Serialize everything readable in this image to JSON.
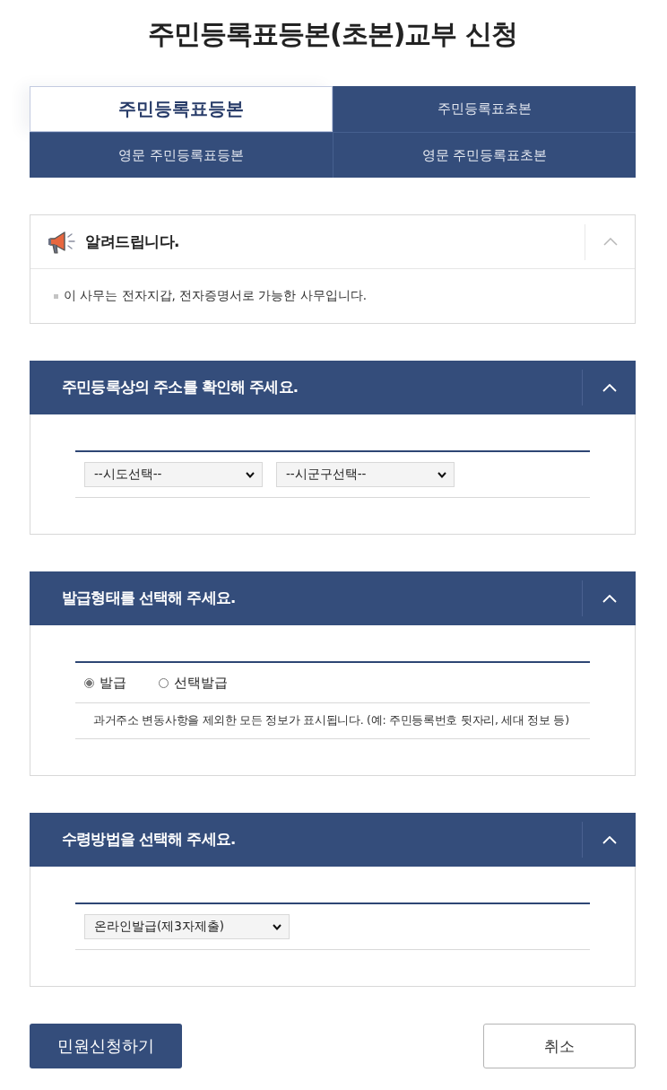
{
  "page_title": "주민등록표등본(초본)교부 신청",
  "tabs": [
    {
      "label": "주민등록표등본",
      "selected": true
    },
    {
      "label": "주민등록표초본",
      "selected": false
    },
    {
      "label": "영문 주민등록표등본",
      "selected": false
    },
    {
      "label": "영문 주민등록표초본",
      "selected": false
    }
  ],
  "notice": {
    "title": "알려드립니다.",
    "expanded": true,
    "items": [
      "이 사무는 전자지갑, 전자증명서로 가능한 사무입니다."
    ]
  },
  "sections": [
    {
      "kind": "selects",
      "title": "주민등록상의 주소를 확인해 주세요.",
      "expanded": true,
      "selects": [
        {
          "value": "--시도선택--"
        },
        {
          "value": "--시군구선택--"
        }
      ]
    },
    {
      "kind": "radios",
      "title": "발급형태를 선택해 주세요.",
      "expanded": true,
      "options": [
        {
          "label": "발급",
          "selected": true
        },
        {
          "label": "선택발급",
          "selected": false
        }
      ],
      "description": "과거주소 변동사항을 제외한 모든 정보가 표시됩니다. (예: 주민등록번호 뒷자리, 세대 정보 등)"
    },
    {
      "kind": "selects",
      "title": "수령방법을 선택해 주세요.",
      "expanded": true,
      "selects": [
        {
          "value": "온라인발급(제3자제출)"
        }
      ]
    }
  ],
  "buttons": [
    {
      "label": "민원신청하기",
      "kind": "primary"
    },
    {
      "label": "취소",
      "kind": "secondary"
    }
  ]
}
